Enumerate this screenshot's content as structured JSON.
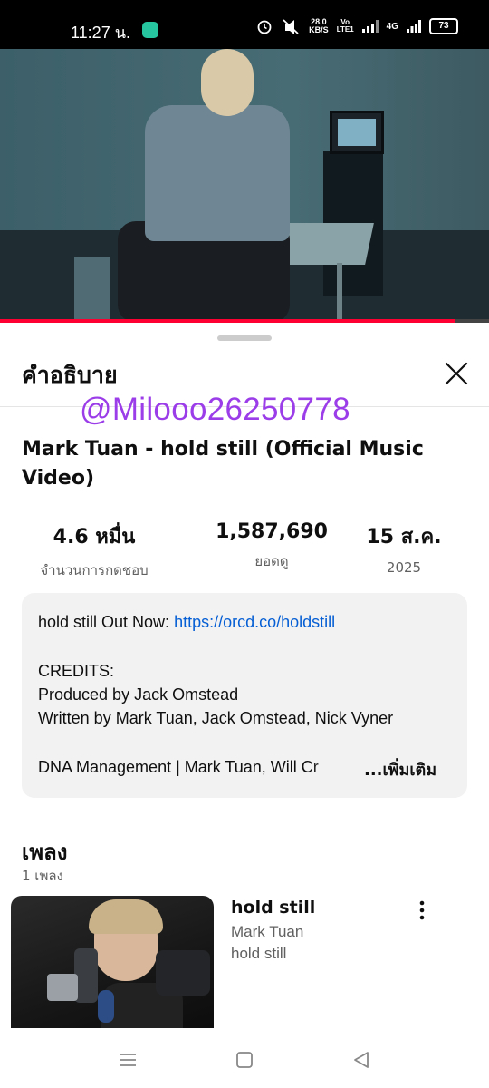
{
  "status_bar": {
    "time": "11:27 น.",
    "net_speed_value": "28.0",
    "net_speed_unit": "KB/S",
    "volte_top": "Vo",
    "volte_bottom": "LTE1",
    "signal_label": "4G",
    "battery": "73",
    "icons": [
      "app-notification-icon",
      "alarm-icon",
      "mute-icon",
      "signal-icon",
      "battery-icon"
    ]
  },
  "video": {
    "progress": 0.93,
    "accent_color": "#ff0033"
  },
  "sheet": {
    "title": "คำอธิบาย",
    "watermark": "@Milooo26250778",
    "video_title": "Mark Tuan - hold still (Official Music Video)",
    "stats": [
      {
        "value": "4.6 หมื่น",
        "label": "จำนวนการกดชอบ"
      },
      {
        "value": "1,587,690",
        "label": "ยอดดู"
      },
      {
        "value": "15 ส.ค.",
        "label": "2025"
      }
    ],
    "description": {
      "line1_prefix": "hold still Out Now: ",
      "line1_link": "https://orcd.co/holdstill",
      "credits_heading": "CREDITS:",
      "produced": "Produced by Jack Omstead",
      "written": "Written by Mark Tuan, Jack Omstead, Nick Vyner",
      "management": "DNA Management | Mark Tuan, Will Cr",
      "more": "...เพิ่มเติม"
    },
    "music": {
      "heading": "เพลง",
      "count": "1 เพลง",
      "song": {
        "title": "hold still",
        "artist": "Mark Tuan",
        "album": "hold still"
      }
    }
  },
  "nav": {
    "icons": [
      "recent-apps-icon",
      "home-icon",
      "back-icon"
    ]
  }
}
